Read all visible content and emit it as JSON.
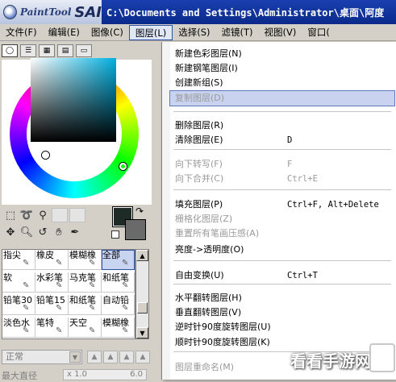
{
  "titlebar": {
    "logo_text": "PaintTool",
    "logo_brand": "SAI",
    "path": "C:\\Documents and Settings\\Administrator\\桌面\\阿度"
  },
  "menubar": [
    "文件(F)",
    "编辑(E)",
    "图像(C)",
    "图层(L)",
    "选择(S)",
    "滤镜(T)",
    "视图(V)",
    "窗口("
  ],
  "color_tabs": [
    "wheel",
    "slider",
    "grid",
    "palette",
    "tray"
  ],
  "color": {
    "foreground": "#1e2a26",
    "background": "#6a6a6a"
  },
  "tools": {
    "row1": [
      "select-rect-icon",
      "lasso-icon",
      "magic-wand-icon",
      "blank",
      "blank"
    ],
    "row2": [
      "move-icon",
      "zoom-icon",
      "rotate-icon",
      "hand-icon",
      "eyedropper-icon"
    ]
  },
  "brushes": [
    [
      "指尖",
      "橡皮",
      "模糊橡",
      "全部"
    ],
    [
      "软",
      "水彩笔",
      "马克笔",
      "和纸笔"
    ],
    [
      "铅笔30",
      "铅笔15",
      "和纸笔",
      "自动铅"
    ],
    [
      "淡色水",
      "笔特",
      "天空",
      "模糊橡"
    ]
  ],
  "brush_selected": [
    0,
    3
  ],
  "blend_mode": "正常",
  "max_size": {
    "label": "最大直径",
    "mult": "x 1.0",
    "value": "6.0"
  },
  "layer_menu": {
    "items": [
      {
        "label": "新建色彩图层(N)",
        "shortcut": "",
        "disabled": false
      },
      {
        "label": "新建钢笔图层(I)",
        "shortcut": "",
        "disabled": false
      },
      {
        "label": "创建新组(S)",
        "shortcut": "",
        "disabled": false
      },
      {
        "label": "复制图层(D)",
        "shortcut": "",
        "disabled": true,
        "highlight": true
      },
      {
        "label": "删除图层(R)",
        "shortcut": "",
        "disabled": false
      },
      {
        "label": "清除图层(E)",
        "shortcut": "D",
        "disabled": false
      },
      {
        "label": "向下转写(F)",
        "shortcut": "F",
        "disabled": true
      },
      {
        "label": "向下合并(C)",
        "shortcut": "Ctrl+E",
        "disabled": true
      },
      {
        "label": "填充图层(P)",
        "shortcut": "Ctrl+F, Alt+Delete",
        "disabled": false
      },
      {
        "label": "栅格化图层(Z)",
        "shortcut": "",
        "disabled": true
      },
      {
        "label": "重置所有笔画压感(A)",
        "shortcut": "",
        "disabled": true
      },
      {
        "label": "亮度->透明度(O)",
        "shortcut": "",
        "disabled": false
      },
      {
        "label": "自由变换(U)",
        "shortcut": "Ctrl+T",
        "disabled": false
      },
      {
        "label": "水平翻转图层(H)",
        "shortcut": "",
        "disabled": false
      },
      {
        "label": "垂直翻转图层(V)",
        "shortcut": "",
        "disabled": false
      },
      {
        "label": "逆时针90度旋转图层(U)",
        "shortcut": "",
        "disabled": false
      },
      {
        "label": "顺时针90度旋转图层(K)",
        "shortcut": "",
        "disabled": false
      },
      {
        "label": "图层重命名(M)",
        "shortcut": "",
        "disabled": true
      }
    ]
  },
  "watermark": "看看手游网"
}
